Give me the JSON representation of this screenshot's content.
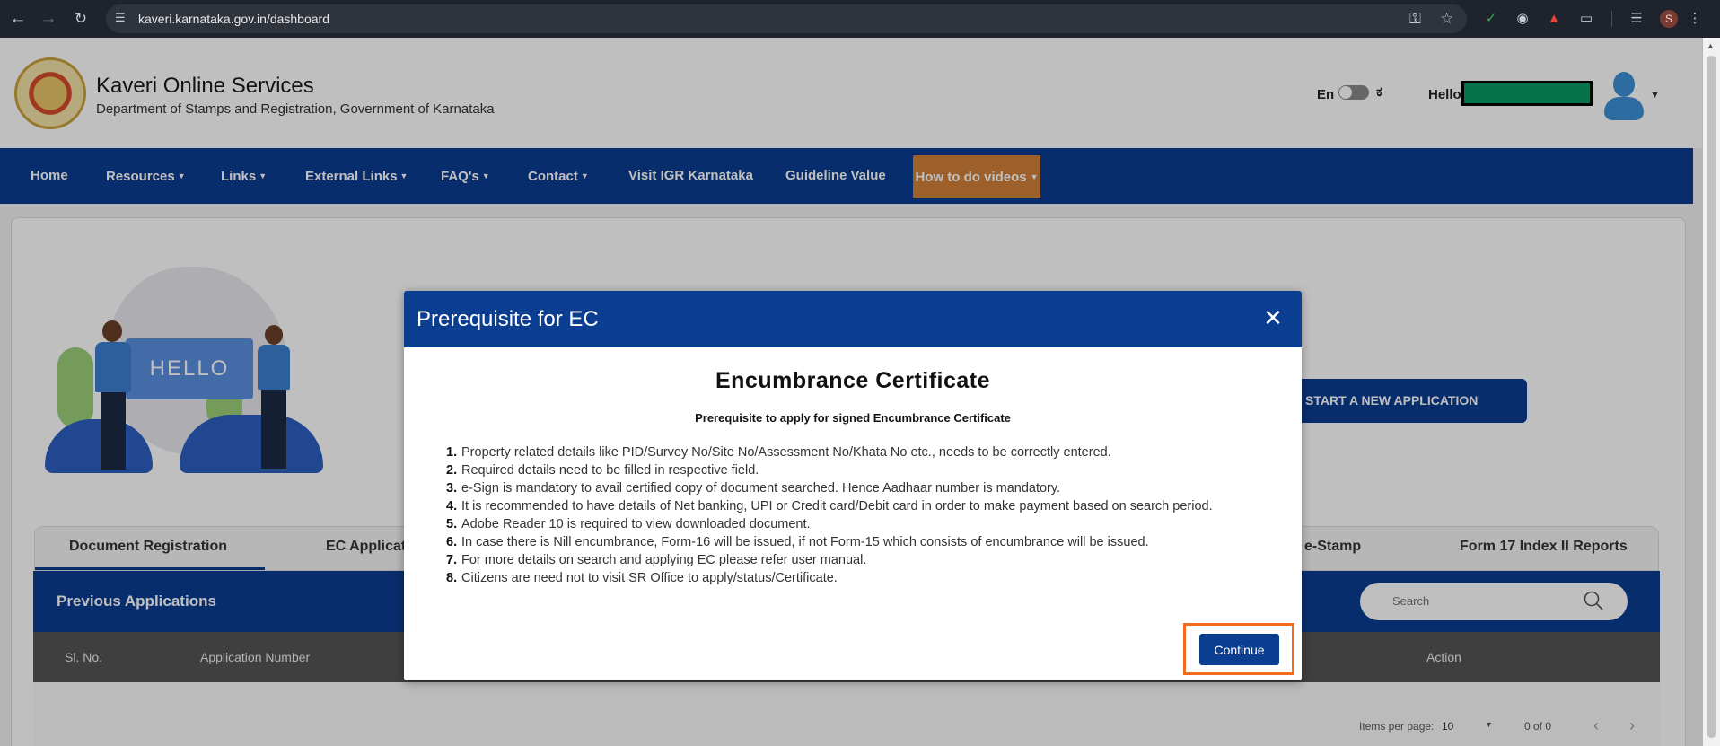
{
  "browser": {
    "url": "kaveri.karnataka.gov.in/dashboard",
    "profile_initial": "S"
  },
  "header": {
    "title": "Kaveri Online Services",
    "subtitle": "Department of Stamps and Registration, Government of Karnataka",
    "lang_en": "En",
    "lang_kn": "ಕ",
    "greeting": "Hello"
  },
  "menu": {
    "items": [
      {
        "label": "Home",
        "dropdown": false
      },
      {
        "label": "Resources",
        "dropdown": true
      },
      {
        "label": "Links",
        "dropdown": true
      },
      {
        "label": "External Links",
        "dropdown": true
      },
      {
        "label": "FAQ's",
        "dropdown": true
      },
      {
        "label": "Contact",
        "dropdown": true
      },
      {
        "label": "Visit IGR Karnataka",
        "dropdown": false
      },
      {
        "label": "Guideline Value",
        "dropdown": false
      }
    ],
    "highlight": "How to do videos"
  },
  "hero": {
    "board_text": "HELLO",
    "start_button": "START A NEW APPLICATION"
  },
  "tabs": [
    "Document Registration",
    "EC Applicat",
    "e-Stamp",
    "Form 17 Index II Reports"
  ],
  "applications": {
    "title": "Previous Applications",
    "search_placeholder": "Search",
    "columns": [
      "Sl. No.",
      "Application Number",
      "Action"
    ],
    "items_per_page_label": "Items per page:",
    "items_per_page": "10",
    "range": "0 of 0"
  },
  "modal": {
    "title": "Prerequisite for EC",
    "heading": "Encumbrance Certificate",
    "subheading": "Prerequisite to apply for signed Encumbrance Certificate",
    "rules": [
      "Property related details like PID/Survey No/Site No/Assessment No/Khata No etc., needs to be correctly entered.",
      "Required details need to be filled in respective field.",
      "e-Sign is mandatory to avail certified copy of document searched. Hence Aadhaar number is mandatory.",
      "It is recommended to have details of Net banking, UPI or Credit card/Debit card in order to make payment based on search period.",
      "Adobe Reader 10 is required to view downloaded document.",
      "In case there is Nill encumbrance, Form-16 will be issued, if not Form-15 which consists of encumbrance will be issued.",
      "For more details on search and applying EC please refer user manual.",
      "Citizens are need not to visit SR Office to apply/status/Certificate."
    ],
    "continue_label": "Continue"
  },
  "colors": {
    "primary": "#0b3d91",
    "accent": "#d2813a",
    "highlight_frame": "#f26c1d"
  }
}
